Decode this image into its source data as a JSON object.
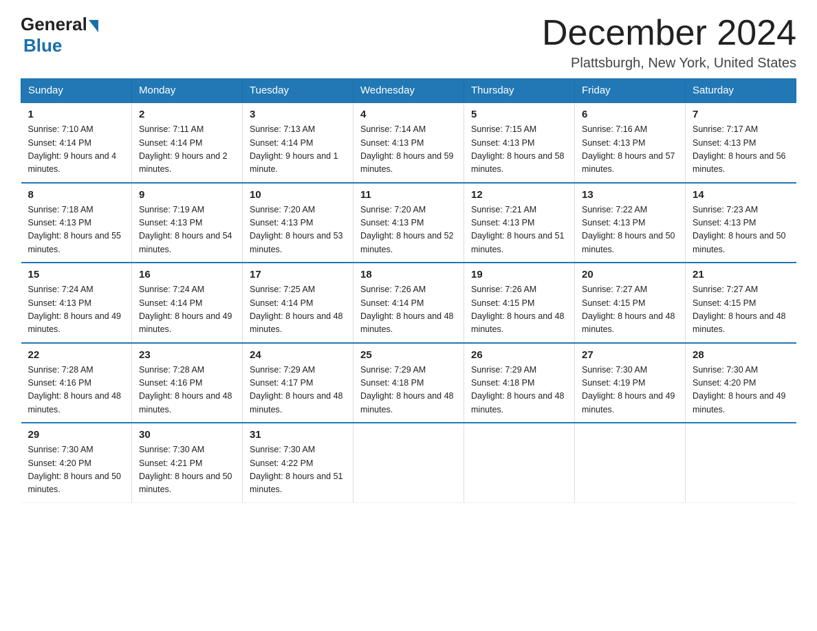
{
  "header": {
    "logo_general": "General",
    "logo_blue": "Blue",
    "month_title": "December 2024",
    "location": "Plattsburgh, New York, United States"
  },
  "days_of_week": [
    "Sunday",
    "Monday",
    "Tuesday",
    "Wednesday",
    "Thursday",
    "Friday",
    "Saturday"
  ],
  "weeks": [
    [
      {
        "day": "1",
        "sunrise": "7:10 AM",
        "sunset": "4:14 PM",
        "daylight": "9 hours and 4 minutes."
      },
      {
        "day": "2",
        "sunrise": "7:11 AM",
        "sunset": "4:14 PM",
        "daylight": "9 hours and 2 minutes."
      },
      {
        "day": "3",
        "sunrise": "7:13 AM",
        "sunset": "4:14 PM",
        "daylight": "9 hours and 1 minute."
      },
      {
        "day": "4",
        "sunrise": "7:14 AM",
        "sunset": "4:13 PM",
        "daylight": "8 hours and 59 minutes."
      },
      {
        "day": "5",
        "sunrise": "7:15 AM",
        "sunset": "4:13 PM",
        "daylight": "8 hours and 58 minutes."
      },
      {
        "day": "6",
        "sunrise": "7:16 AM",
        "sunset": "4:13 PM",
        "daylight": "8 hours and 57 minutes."
      },
      {
        "day": "7",
        "sunrise": "7:17 AM",
        "sunset": "4:13 PM",
        "daylight": "8 hours and 56 minutes."
      }
    ],
    [
      {
        "day": "8",
        "sunrise": "7:18 AM",
        "sunset": "4:13 PM",
        "daylight": "8 hours and 55 minutes."
      },
      {
        "day": "9",
        "sunrise": "7:19 AM",
        "sunset": "4:13 PM",
        "daylight": "8 hours and 54 minutes."
      },
      {
        "day": "10",
        "sunrise": "7:20 AM",
        "sunset": "4:13 PM",
        "daylight": "8 hours and 53 minutes."
      },
      {
        "day": "11",
        "sunrise": "7:20 AM",
        "sunset": "4:13 PM",
        "daylight": "8 hours and 52 minutes."
      },
      {
        "day": "12",
        "sunrise": "7:21 AM",
        "sunset": "4:13 PM",
        "daylight": "8 hours and 51 minutes."
      },
      {
        "day": "13",
        "sunrise": "7:22 AM",
        "sunset": "4:13 PM",
        "daylight": "8 hours and 50 minutes."
      },
      {
        "day": "14",
        "sunrise": "7:23 AM",
        "sunset": "4:13 PM",
        "daylight": "8 hours and 50 minutes."
      }
    ],
    [
      {
        "day": "15",
        "sunrise": "7:24 AM",
        "sunset": "4:13 PM",
        "daylight": "8 hours and 49 minutes."
      },
      {
        "day": "16",
        "sunrise": "7:24 AM",
        "sunset": "4:14 PM",
        "daylight": "8 hours and 49 minutes."
      },
      {
        "day": "17",
        "sunrise": "7:25 AM",
        "sunset": "4:14 PM",
        "daylight": "8 hours and 48 minutes."
      },
      {
        "day": "18",
        "sunrise": "7:26 AM",
        "sunset": "4:14 PM",
        "daylight": "8 hours and 48 minutes."
      },
      {
        "day": "19",
        "sunrise": "7:26 AM",
        "sunset": "4:15 PM",
        "daylight": "8 hours and 48 minutes."
      },
      {
        "day": "20",
        "sunrise": "7:27 AM",
        "sunset": "4:15 PM",
        "daylight": "8 hours and 48 minutes."
      },
      {
        "day": "21",
        "sunrise": "7:27 AM",
        "sunset": "4:15 PM",
        "daylight": "8 hours and 48 minutes."
      }
    ],
    [
      {
        "day": "22",
        "sunrise": "7:28 AM",
        "sunset": "4:16 PM",
        "daylight": "8 hours and 48 minutes."
      },
      {
        "day": "23",
        "sunrise": "7:28 AM",
        "sunset": "4:16 PM",
        "daylight": "8 hours and 48 minutes."
      },
      {
        "day": "24",
        "sunrise": "7:29 AM",
        "sunset": "4:17 PM",
        "daylight": "8 hours and 48 minutes."
      },
      {
        "day": "25",
        "sunrise": "7:29 AM",
        "sunset": "4:18 PM",
        "daylight": "8 hours and 48 minutes."
      },
      {
        "day": "26",
        "sunrise": "7:29 AM",
        "sunset": "4:18 PM",
        "daylight": "8 hours and 48 minutes."
      },
      {
        "day": "27",
        "sunrise": "7:30 AM",
        "sunset": "4:19 PM",
        "daylight": "8 hours and 49 minutes."
      },
      {
        "day": "28",
        "sunrise": "7:30 AM",
        "sunset": "4:20 PM",
        "daylight": "8 hours and 49 minutes."
      }
    ],
    [
      {
        "day": "29",
        "sunrise": "7:30 AM",
        "sunset": "4:20 PM",
        "daylight": "8 hours and 50 minutes."
      },
      {
        "day": "30",
        "sunrise": "7:30 AM",
        "sunset": "4:21 PM",
        "daylight": "8 hours and 50 minutes."
      },
      {
        "day": "31",
        "sunrise": "7:30 AM",
        "sunset": "4:22 PM",
        "daylight": "8 hours and 51 minutes."
      },
      null,
      null,
      null,
      null
    ]
  ]
}
